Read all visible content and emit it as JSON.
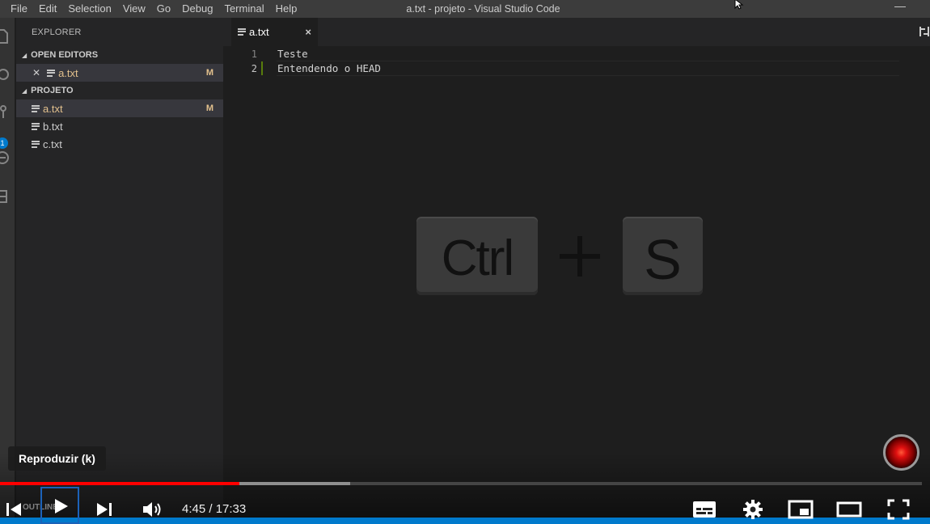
{
  "window": {
    "title": "a.txt - projeto - Visual Studio Code",
    "menu": [
      "File",
      "Edit",
      "Selection",
      "View",
      "Go",
      "Debug",
      "Terminal",
      "Help"
    ],
    "minimize_glyph": "—"
  },
  "activity_bar": {
    "icons": [
      "files-icon",
      "search-icon",
      "source-control-icon",
      "debug-icon",
      "extensions-icon"
    ],
    "scm_badge": "1"
  },
  "sidebar": {
    "title": "EXPLORER",
    "open_editors": {
      "header": "OPEN EDITORS",
      "items": [
        {
          "name": "a.txt",
          "status": "M"
        }
      ]
    },
    "project": {
      "header": "PROJETO",
      "files": [
        {
          "name": "a.txt",
          "status": "M"
        },
        {
          "name": "b.txt",
          "status": ""
        },
        {
          "name": "c.txt",
          "status": ""
        }
      ]
    },
    "outline_header": "OUTLINE"
  },
  "tabs": [
    {
      "label": "a.txt",
      "close": "×"
    }
  ],
  "editor": {
    "lines": [
      {
        "number": "1",
        "text": "Teste"
      },
      {
        "number": "2",
        "text": "Entendendo o HEAD"
      }
    ]
  },
  "keys_overlay": {
    "key1": "Ctrl",
    "key2": "S"
  },
  "player": {
    "tooltip": "Reproduzir (k)",
    "current_time": "4:45",
    "duration": "17:33",
    "time_display": "4:45 / 17:33",
    "played_fraction": 0.26,
    "buffered_fraction": 0.38
  },
  "colors": {
    "accent": "#007acc",
    "progress": "#ff0000",
    "modified": "#e2c08d"
  }
}
